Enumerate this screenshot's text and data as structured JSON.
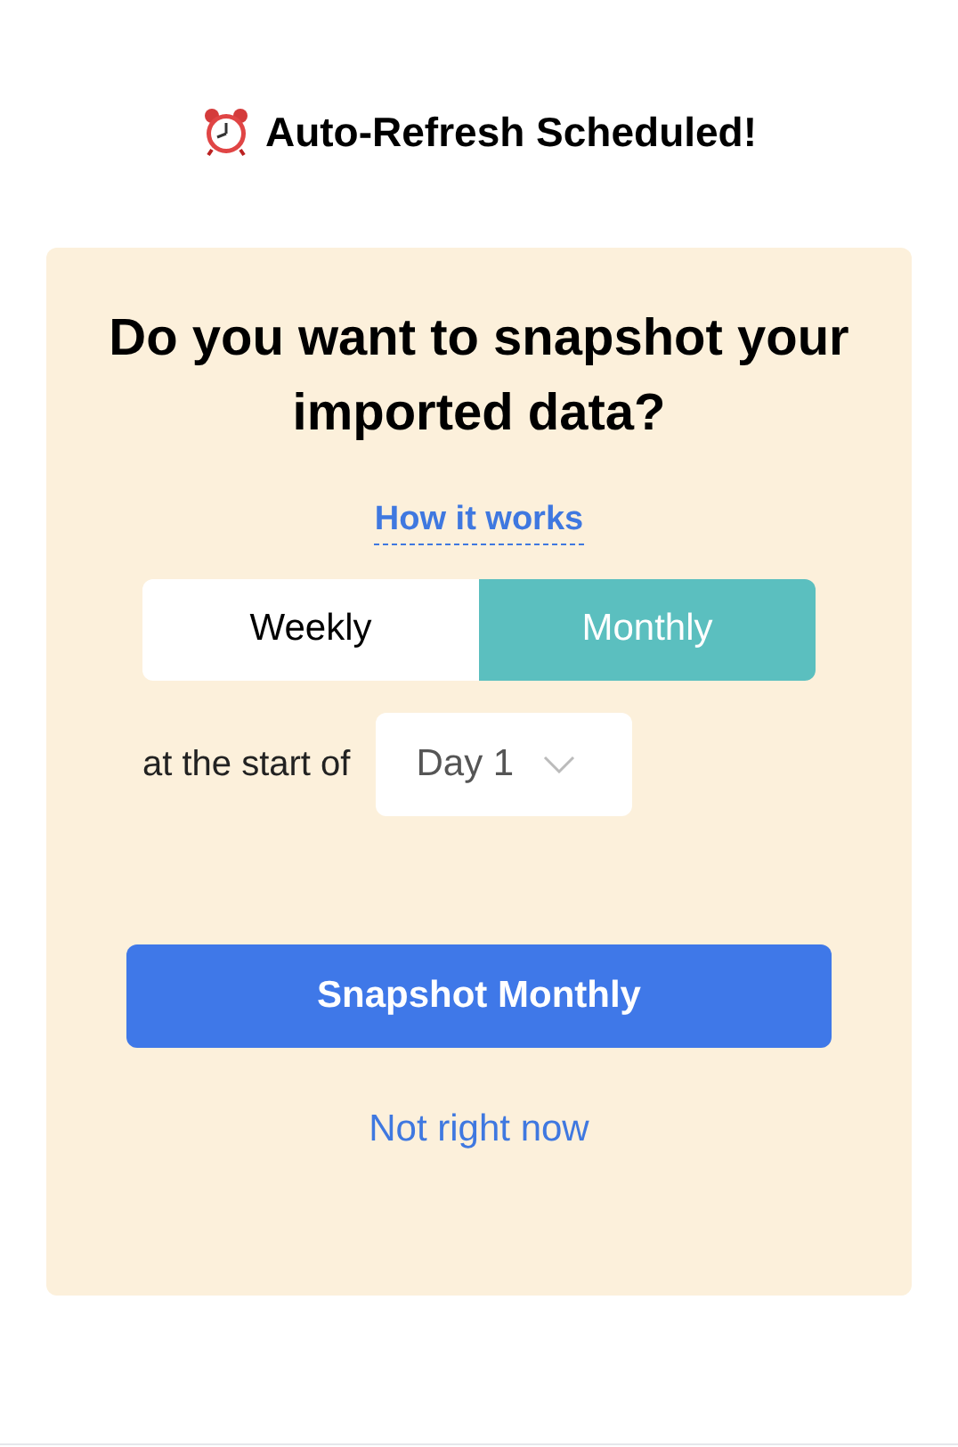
{
  "header": {
    "title": "Auto-Refresh Scheduled!"
  },
  "card": {
    "heading": "Do you want to snapshot your imported data?",
    "help_link": "How it works",
    "frequency_tabs": [
      {
        "label": "Weekly",
        "selected": false
      },
      {
        "label": "Monthly",
        "selected": true
      }
    ],
    "start_label": "at the start of",
    "day_select": {
      "value": "Day 1"
    },
    "primary_button": "Snapshot Monthly",
    "secondary_link": "Not right now"
  }
}
